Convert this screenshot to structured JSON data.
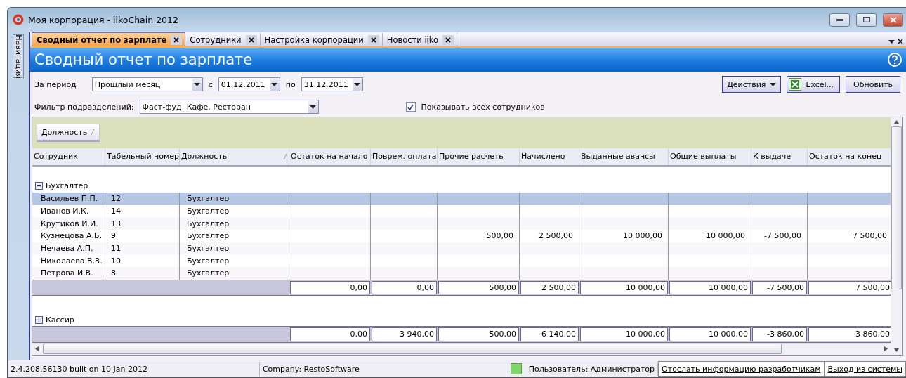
{
  "window": {
    "title": "Моя корпорация - iikoChain 2012"
  },
  "side_tab": "Навигация",
  "tabs": [
    {
      "label": "Сводный отчет по зарплате",
      "selected": true
    },
    {
      "label": "Сотрудники",
      "selected": false
    },
    {
      "label": "Настройка корпорации",
      "selected": false
    },
    {
      "label": "Новости iiko",
      "selected": false
    }
  ],
  "header": {
    "title": "Сводный отчет по зарплате"
  },
  "filters": {
    "period_label": "За период",
    "period": "Прошлый месяц",
    "from_label": "с",
    "from": "01.12.2011",
    "to_label": "по",
    "to": "31.12.2011",
    "division_label": "Фильтр подразделений:",
    "division": "Фаст-фуд, Кафе, Ресторан",
    "show_all": {
      "label": "Показывать всех сотрудников",
      "checked": true
    }
  },
  "actions": [
    {
      "label": "Действия",
      "kind": "menu"
    },
    {
      "label": "Excel...",
      "kind": "excel"
    },
    {
      "label": "Обновить",
      "kind": "plain"
    }
  ],
  "grid": {
    "group_by": "Должность",
    "columns": [
      {
        "label": "Сотрудник",
        "sorted": false
      },
      {
        "label": "Табельный номер",
        "sorted": false
      },
      {
        "label": "Должность",
        "sorted": true
      },
      {
        "label": "Остаток на начало",
        "sorted": false
      },
      {
        "label": "Поврем. оплата",
        "sorted": false
      },
      {
        "label": "Прочие расчеты",
        "sorted": false
      },
      {
        "label": "Начислено",
        "sorted": false
      },
      {
        "label": "Выданные авансы",
        "sorted": false
      },
      {
        "label": "Общие выплаты",
        "sorted": false
      },
      {
        "label": "К выдаче",
        "sorted": false
      },
      {
        "label": "Остаток на конец",
        "sorted": false
      }
    ],
    "groups": [
      {
        "name": "Бухгалтер",
        "expanded": true,
        "rows": [
          {
            "selected": true,
            "cells": [
              "Васильев П.П.",
              "12",
              "Бухгалтер"
            ]
          },
          {
            "selected": false,
            "cells": [
              "Иванов И.К.",
              "14",
              "Бухгалтер"
            ]
          },
          {
            "selected": false,
            "cells": [
              "Крутиков И.И.",
              "13",
              "Бухгалтер"
            ]
          },
          {
            "selected": false,
            "cells": [
              "Кузнецова А.Б.",
              "9",
              "Бухгалтер",
              "",
              "",
              "500,00",
              "2 500,00",
              "10 000,00",
              "10 000,00",
              "-7 500,00",
              "7 500,00"
            ]
          },
          {
            "selected": false,
            "cells": [
              "Нечаева А.П.",
              "11",
              "Бухгалтер"
            ]
          },
          {
            "selected": false,
            "cells": [
              "Николаева В.З.",
              "10",
              "Бухгалтер"
            ]
          },
          {
            "selected": false,
            "cells": [
              "Петрова И.В.",
              "8",
              "Бухгалтер"
            ]
          }
        ],
        "totals": [
          "0,00",
          "0,00",
          "500,00",
          "2 500,00",
          "10 000,00",
          "10 000,00",
          "-7 500,00",
          "7 500,00"
        ]
      },
      {
        "name": "Кассир",
        "expanded": false,
        "totals": [
          "0,00",
          "3 940,00",
          "500,00",
          "6 140,00",
          "10 000,00",
          "10 000,00",
          "-3 860,00",
          "3 860,00"
        ]
      }
    ]
  },
  "status_bar": {
    "version": "2.4.208.56130 built on 10 Jan 2012",
    "company": "Company: RestoSoftware",
    "user": "Пользователь: Администратор",
    "send_link": "Отослать информацию разработчикам",
    "logout_link": "Выход из системы"
  }
}
